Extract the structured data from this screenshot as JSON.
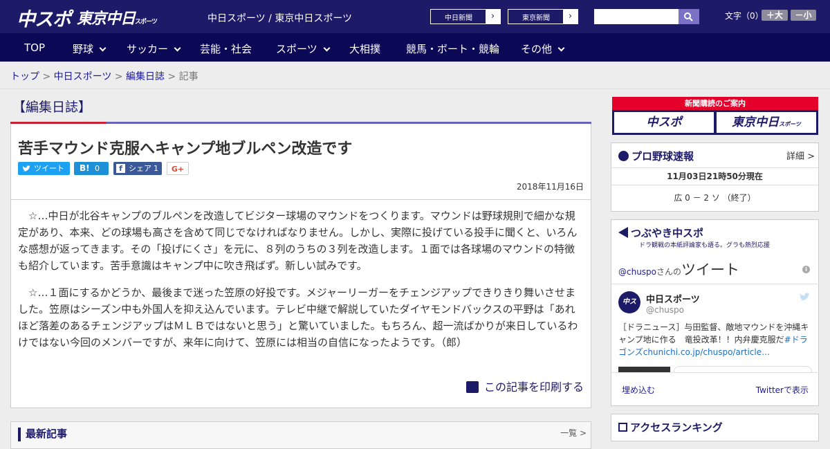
{
  "header": {
    "logo_chuspo": "中スポ",
    "logo_tokyo": "東京中日",
    "logo_tokyo_sub": "スポーツ",
    "site_title": "中日スポーツ / 東京中日スポーツ",
    "paper_buttons": [
      "中日新聞",
      "東京新聞"
    ],
    "search_placeholder": "",
    "font_size_label": "文字（0）",
    "font_bigger": "＋大",
    "font_smaller": "－小"
  },
  "nav": {
    "items": [
      {
        "label": "TOP"
      },
      {
        "label": "野球"
      },
      {
        "label": "サッカー"
      },
      {
        "label": "芸能・社会"
      },
      {
        "label": "スポーツ"
      },
      {
        "label": "大相撲"
      },
      {
        "label": "競馬・ボート・競輪"
      },
      {
        "label": "その他"
      }
    ]
  },
  "breadcrumb": {
    "items": [
      "トップ",
      "中日スポーツ",
      "編集日誌"
    ],
    "current": "記事",
    "separator": " > "
  },
  "section_title": "【編集日誌】",
  "article": {
    "headline": "苦手マウンド克服へキャンプ地ブルペン改造です",
    "share": {
      "tweet": "ツイート",
      "hatena": "B!",
      "hatena_count": "0",
      "facebook": "シェア",
      "facebook_count": "1",
      "gplus": "G+"
    },
    "date": "2018年11月16日",
    "paragraphs": [
      "☆…中日が北谷キャンプのブルペンを改造してビジター球場のマウンドをつくります。マウンドは野球規則で細かな規定があり、本来、どの球場も高さを含めて同じでなければなりません。しかし、実際に投げている投手に聞くと、いろんな感想が返ってきます。その「投げにくさ」を元に、８列のうちの３列を改造します。１面では各球場のマウンドの特徴も紹介しています。苦手意識はキャンプ中に吹き飛ばず。新しい試みです。",
      "☆…１面にするかどうか、最後まで迷った笠原の好投です。メジャーリーガーをチェンジアップできりきり舞いさせました。笠原はシーズン中も外国人を抑え込んでいます。テレビ中継で解説していたダイヤモンドバックスの平野は「あれほど落差のあるチェンジアップはＭＬＢではないと思う」と驚いていました。もちろん、超一流ばかりが来日しているわけではない今回のメンバーですが、来年に向けて、笠原には相当の自信になったようです。（郎）"
    ],
    "print_label": "この記事を印刷する"
  },
  "latest": {
    "title": "最新記事",
    "more": "一覧 >"
  },
  "sidebar": {
    "banner_top": "新聞購読のご案内",
    "banner_left": "中スポ",
    "banner_right": "東京中日",
    "banner_right_sub": "スポーツ",
    "baseball": {
      "title": "プロ野球速報",
      "detail": "詳細 >",
      "time": "11月03日21時50分現在",
      "score": "広 0 － 2 ソ （終了）"
    },
    "twitter": {
      "title": "つぶやき中スポ",
      "subtitle": "ドラ観戦の本紙評論家も語る。グラも熱烈応援",
      "handle_line_pre": "@chuspo",
      "handle_line_mid": "さんの",
      "handle_line_big": "ツイート",
      "info_icon": "i",
      "user_name": "中日スポーツ",
      "user_handle": "@chuspo",
      "tweet_text_a": "［ドラニュース］与田監督、敵地マウンドを沖縄キャンプ地に作る　竜投改革！！内弁慶克服だ",
      "tweet_link": "#ドラゴンズchunichi.co.jp/chuspo/article…",
      "embed": "埋め込む",
      "view_on_twitter": "Twitterで表示"
    },
    "ranking": {
      "title": "アクセスランキング"
    }
  },
  "colors": {
    "header_bg": "#1d1a68",
    "nav_bg": "#0b0855",
    "accent_red": "#e4002b",
    "link": "#1d1a9a",
    "twitter": "#1da1f2",
    "facebook": "#3b5998"
  }
}
